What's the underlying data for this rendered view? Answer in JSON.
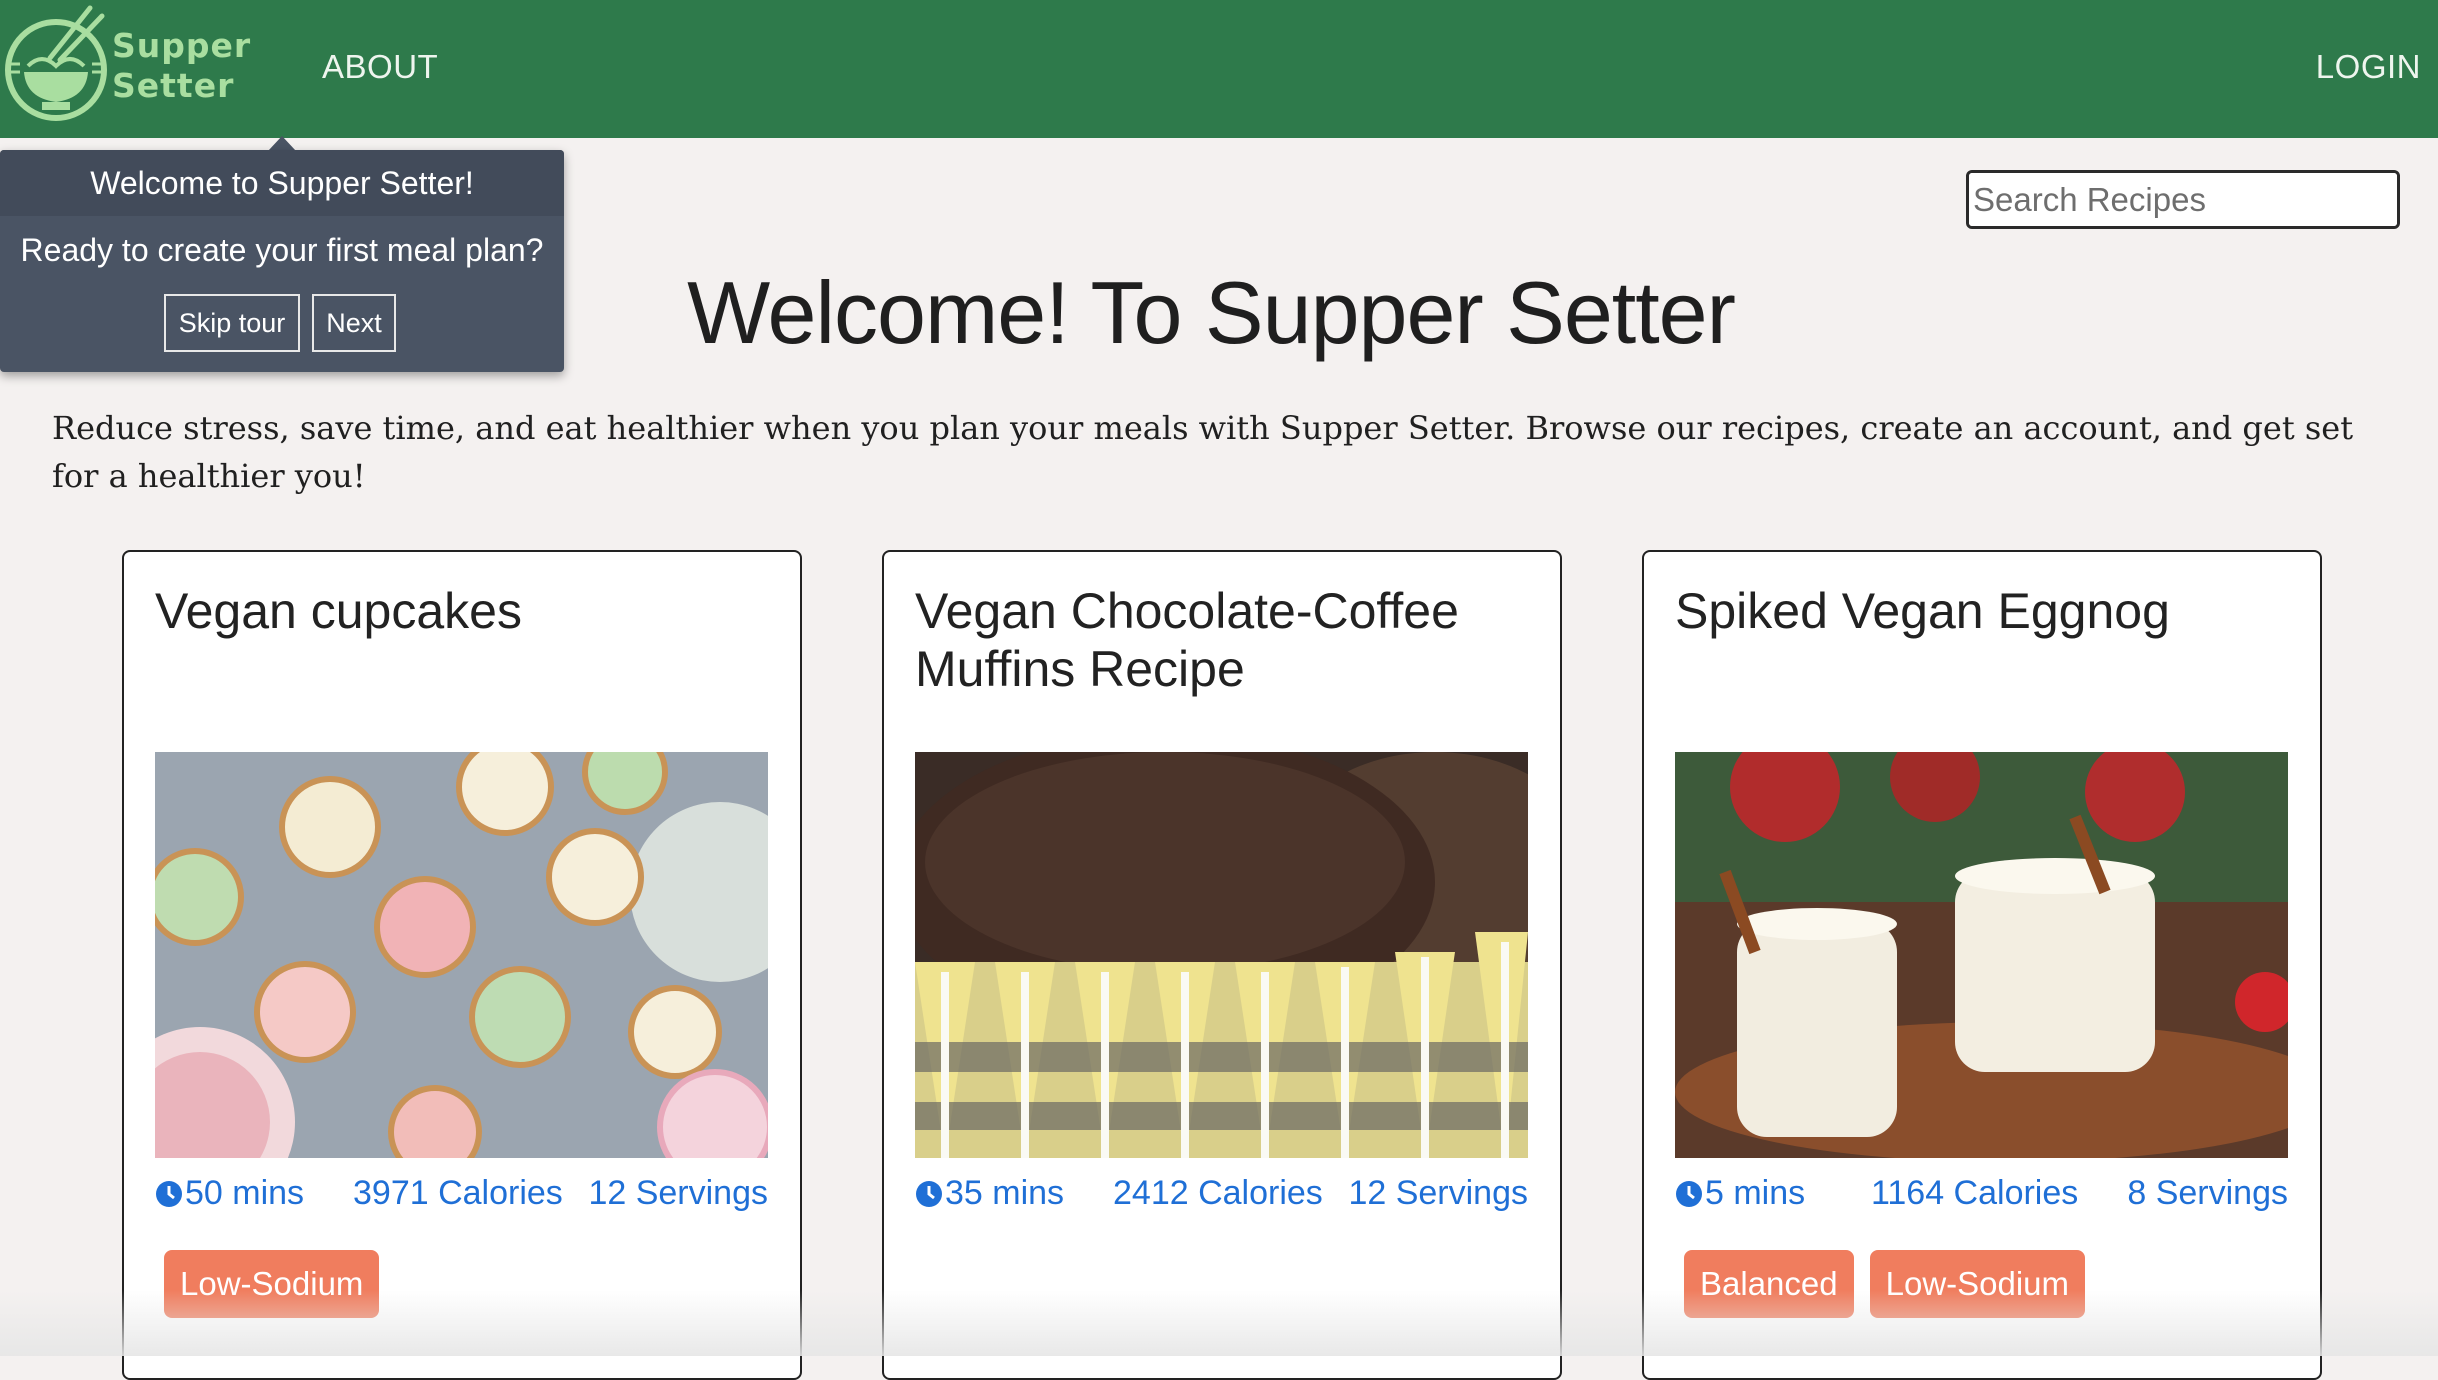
{
  "brand": {
    "line1": "Supper",
    "line2": "Setter"
  },
  "nav": {
    "about": "ABOUT",
    "login": "LOGIN"
  },
  "search": {
    "placeholder": "Search Recipes"
  },
  "tour": {
    "title": "Welcome to Supper Setter!",
    "body": "Ready to create your first meal plan?",
    "skip": "Skip tour",
    "next": "Next"
  },
  "headline": "Welcome! To Supper Setter",
  "intro": "Reduce stress, save time, and eat healthier when you plan your meals with Supper Setter. Browse our recipes, create an account, and get set for a healthier you!",
  "recipes": [
    {
      "title": "Vegan cupcakes",
      "time": "50 mins",
      "calories": "3971 Calories",
      "servings": "12 Servings",
      "tags": [
        "Low-Sodium"
      ]
    },
    {
      "title": "Vegan Chocolate-Coffee Muffins Recipe",
      "time": "35 mins",
      "calories": "2412 Calories",
      "servings": "12 Servings",
      "tags": []
    },
    {
      "title": "Spiked Vegan Eggnog",
      "time": "5 mins",
      "calories": "1164 Calories",
      "servings": "8 Servings",
      "tags": [
        "Balanced",
        "Low-Sodium"
      ]
    }
  ],
  "colors": {
    "nav": "#2e7a4b",
    "brand": "#a9dea0",
    "link": "#1f6fd6",
    "tag": "#f07d5e",
    "search_button": "#2b8ab3"
  }
}
